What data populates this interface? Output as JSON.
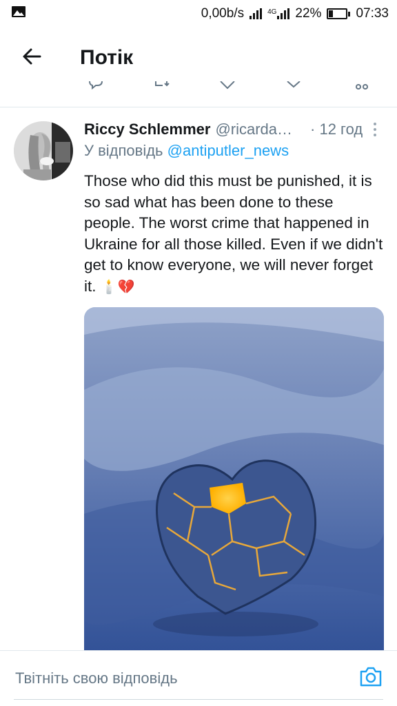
{
  "status_bar": {
    "speed": "0,00b/s",
    "network": "4G",
    "battery": "22%",
    "battery_level": 0.22,
    "time": "07:33",
    "left_icon": "gallery-icon"
  },
  "app_bar": {
    "back_icon": "arrow-left-icon",
    "title": "Потік"
  },
  "tweet": {
    "author_name": "Riccy Schlemmer",
    "author_handle": "@ricarda…",
    "time": "· 12 год",
    "reply_prefix": "У відповідь ",
    "reply_handle": "@antiputler_news",
    "text": "Those who did this must be punished, it is so sad what has been done to these people. The worst crime that happened in Ukraine for all those killed. Even if we didn't get to know everyone, we will never forget it.",
    "emojis": "🕯️💔",
    "media_description_icon": "broken-heart-image"
  },
  "reply_bar": {
    "placeholder": "Твітніть свою відповідь",
    "camera_icon": "camera-icon"
  },
  "colors": {
    "accent": "#1da1f2",
    "secondary_text": "#657786",
    "primary_text": "#14171a",
    "divider": "#e1e8ed"
  }
}
